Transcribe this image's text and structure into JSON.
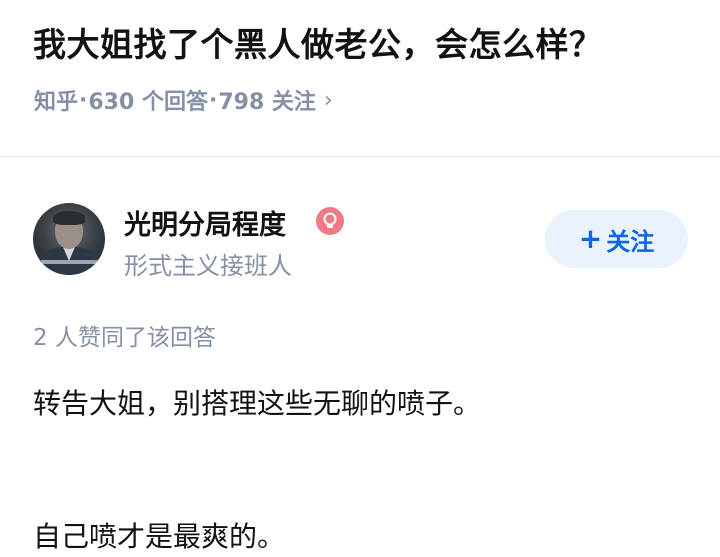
{
  "question": {
    "title": "我大姐找了个黑人做老公，会怎么样？",
    "source": "知乎",
    "answers": "630 个回答",
    "followers": "798 关注",
    "chevron": "›"
  },
  "author": {
    "name": "光明分局程度",
    "bio": "形式主义接班人",
    "badge_icon": "lightbulb-badge-icon",
    "follow_label": "关注",
    "follow_plus": "+"
  },
  "answer": {
    "votes": "2 人赞同了该回答",
    "paragraphs": [
      "转告大姐，别搭理这些无聊的喷子。",
      "自己喷才是最爽的。"
    ]
  },
  "colors": {
    "meta_gray": "#8590a6",
    "follow_blue": "#0c66e4",
    "follow_bg": "#eaf3fd",
    "badge_pink": "#f07a85"
  }
}
